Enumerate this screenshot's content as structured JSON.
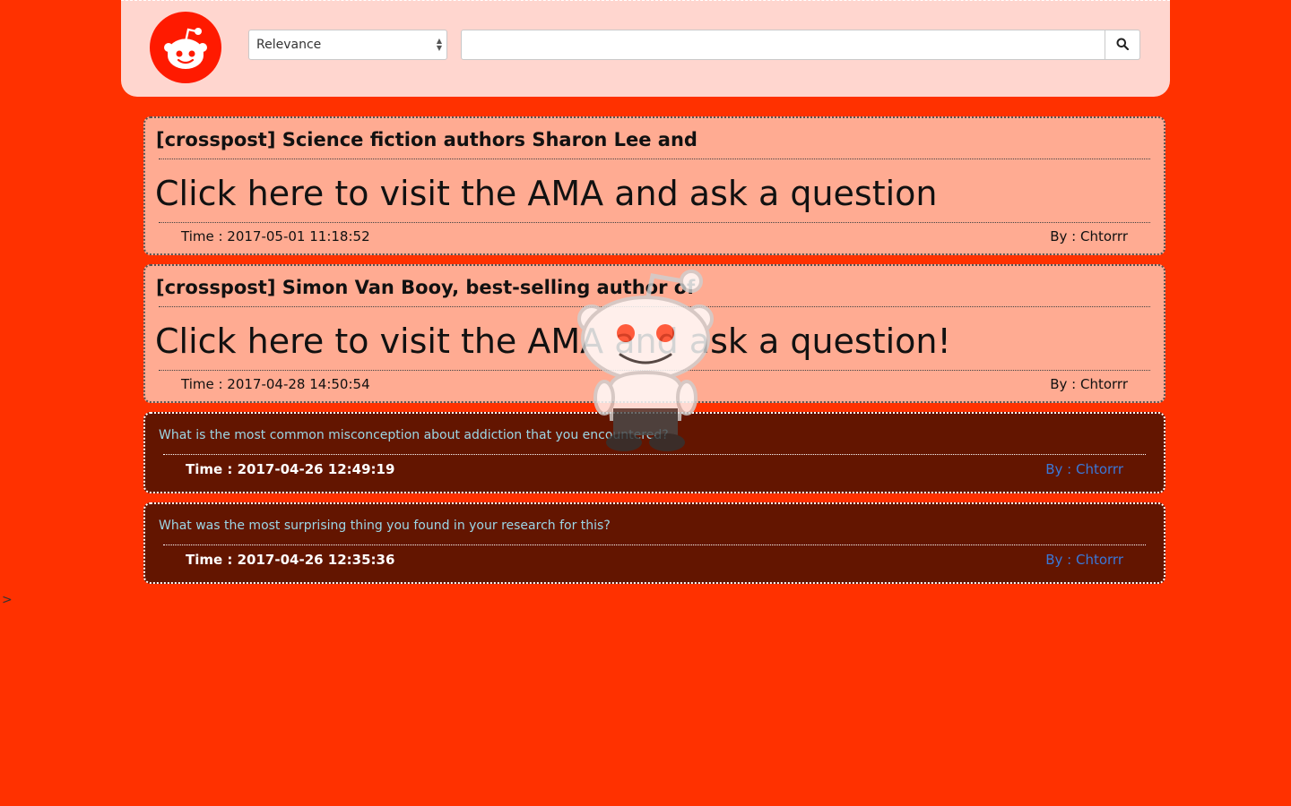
{
  "header": {
    "logo_icon": "reddit-alien-icon",
    "sort_select": {
      "value": "Relevance"
    },
    "search": {
      "placeholder": "",
      "value": "",
      "button_icon": "search-icon"
    }
  },
  "posts": [
    {
      "title": "[crosspost] Science fiction authors Sharon Lee and",
      "link_text": "Click here to visit the AMA and ask a question",
      "time": "Time : 2017-05-01 11:18:52",
      "author": "By : Chtorrr"
    },
    {
      "title": "[crosspost] Simon Van Booy, best-selling author of",
      "link_text": "Click here to visit the AMA and ask a question!",
      "time": "Time : 2017-04-28 14:50:54",
      "author": "By : Chtorrr"
    }
  ],
  "comments": [
    {
      "text": "What is the most common misconception about addiction that you encountered?",
      "time": "Time : 2017-04-26 12:49:19",
      "author": "By : Chtorrr"
    },
    {
      "text": "What was the most surprising thing you found in your research for this?",
      "time": "Time : 2017-04-26 12:35:36",
      "author": "By : Chtorrr"
    }
  ],
  "stray_text": ">",
  "overlay_icon": "reddit-snoo-mascot-icon",
  "colors": {
    "page_background": "#ff3100",
    "header_background": "#ffd6cf",
    "post_background": "#ffab92",
    "comment_background": "#631500",
    "comment_text": "#9cd6e6",
    "comment_author": "#3a78d8"
  }
}
